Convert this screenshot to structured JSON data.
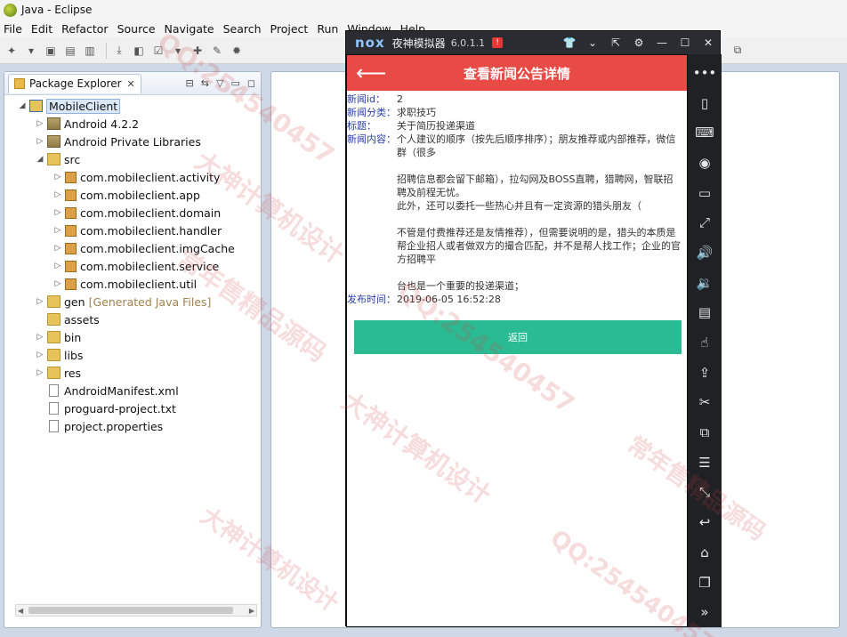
{
  "window": {
    "title": "Java - Eclipse"
  },
  "menu": [
    "File",
    "Edit",
    "Refactor",
    "Source",
    "Navigate",
    "Search",
    "Project",
    "Run",
    "Window",
    "Help"
  ],
  "explorer": {
    "tab_label": "Package Explorer",
    "project": "MobileClient",
    "tree": [
      {
        "label": "Android 4.2.2",
        "kind": "lib",
        "depth": 1,
        "twisty": "▷"
      },
      {
        "label": "Android Private Libraries",
        "kind": "lib",
        "depth": 1,
        "twisty": "▷"
      },
      {
        "label": "src",
        "kind": "src",
        "depth": 1,
        "twisty": "◢"
      },
      {
        "label": "com.mobileclient.activity",
        "kind": "pkg",
        "depth": 2,
        "twisty": "▷"
      },
      {
        "label": "com.mobileclient.app",
        "kind": "pkg",
        "depth": 2,
        "twisty": "▷"
      },
      {
        "label": "com.mobileclient.domain",
        "kind": "pkg",
        "depth": 2,
        "twisty": "▷"
      },
      {
        "label": "com.mobileclient.handler",
        "kind": "pkg",
        "depth": 2,
        "twisty": "▷"
      },
      {
        "label": "com.mobileclient.imgCache",
        "kind": "pkg",
        "depth": 2,
        "twisty": "▷"
      },
      {
        "label": "com.mobileclient.service",
        "kind": "pkg",
        "depth": 2,
        "twisty": "▷"
      },
      {
        "label": "com.mobileclient.util",
        "kind": "pkg",
        "depth": 2,
        "twisty": "▷"
      },
      {
        "label": "gen",
        "note": "[Generated Java Files]",
        "kind": "folder",
        "depth": 1,
        "twisty": "▷"
      },
      {
        "label": "assets",
        "kind": "folder",
        "depth": 1,
        "twisty": ""
      },
      {
        "label": "bin",
        "kind": "folder",
        "depth": 1,
        "twisty": "▷"
      },
      {
        "label": "libs",
        "kind": "folder",
        "depth": 1,
        "twisty": "▷"
      },
      {
        "label": "res",
        "kind": "folder",
        "depth": 1,
        "twisty": "▷"
      },
      {
        "label": "AndroidManifest.xml",
        "kind": "file",
        "depth": 1,
        "twisty": ""
      },
      {
        "label": "proguard-project.txt",
        "kind": "file",
        "depth": 1,
        "twisty": ""
      },
      {
        "label": "project.properties",
        "kind": "file",
        "depth": 1,
        "twisty": ""
      }
    ]
  },
  "nox": {
    "logo": "nox",
    "title": "夜神模拟器",
    "version": "6.0.1.1",
    "alert": "!",
    "controls": [
      "shirt-icon",
      "chevron-down-icon",
      "pin-icon",
      "gear-icon",
      "minimize-icon",
      "maximize-icon",
      "close-icon"
    ],
    "sidebar_icons": [
      "more-icon",
      "phone-icon",
      "keyboard-icon",
      "location-icon",
      "screen-icon",
      "fullscreen-icon",
      "volume-up-icon",
      "volume-down-icon",
      "toolbox-icon",
      "touch-icon",
      "apk-icon",
      "scissors-icon",
      "multi-window-icon",
      "menu-icon",
      "resize-icon",
      "back-icon",
      "home-icon",
      "recent-apps-icon",
      "expand-icon"
    ]
  },
  "app": {
    "header_title": "查看新闻公告详情",
    "fields": {
      "id_label": "新闻id：",
      "id_value": "2",
      "category_label": "新闻分类：",
      "category_value": "求职技巧",
      "title_label": "标题：",
      "title_value": "关于简历投递渠道",
      "content_label": "新闻内容：",
      "content_p1": "个人建议的顺序（按先后顺序排序）；朋友推荐或内部推荐，微信群（很多",
      "content_p2": "招聘信息都会留下邮箱），拉勾网及BOSS直聘，猎聘网，智联招聘及前程无忧。\n此外，还可以委托一些热心并且有一定资源的猎头朋友（",
      "content_p3": "不管是付费推荐还是友情推荐），但需要说明的是，猎头的本质是帮企业招人或者做双方的撮合匹配，并不是帮人找工作；企业的官方招聘平",
      "content_p4": "台也是一个重要的投递渠道；",
      "time_label": "发布时间：",
      "time_value": "2019-06-05 16:52:28"
    },
    "return_label": "返回"
  },
  "watermarks": [
    "QQ:254540457",
    "大神计算机设计",
    "常年售精品源码"
  ]
}
